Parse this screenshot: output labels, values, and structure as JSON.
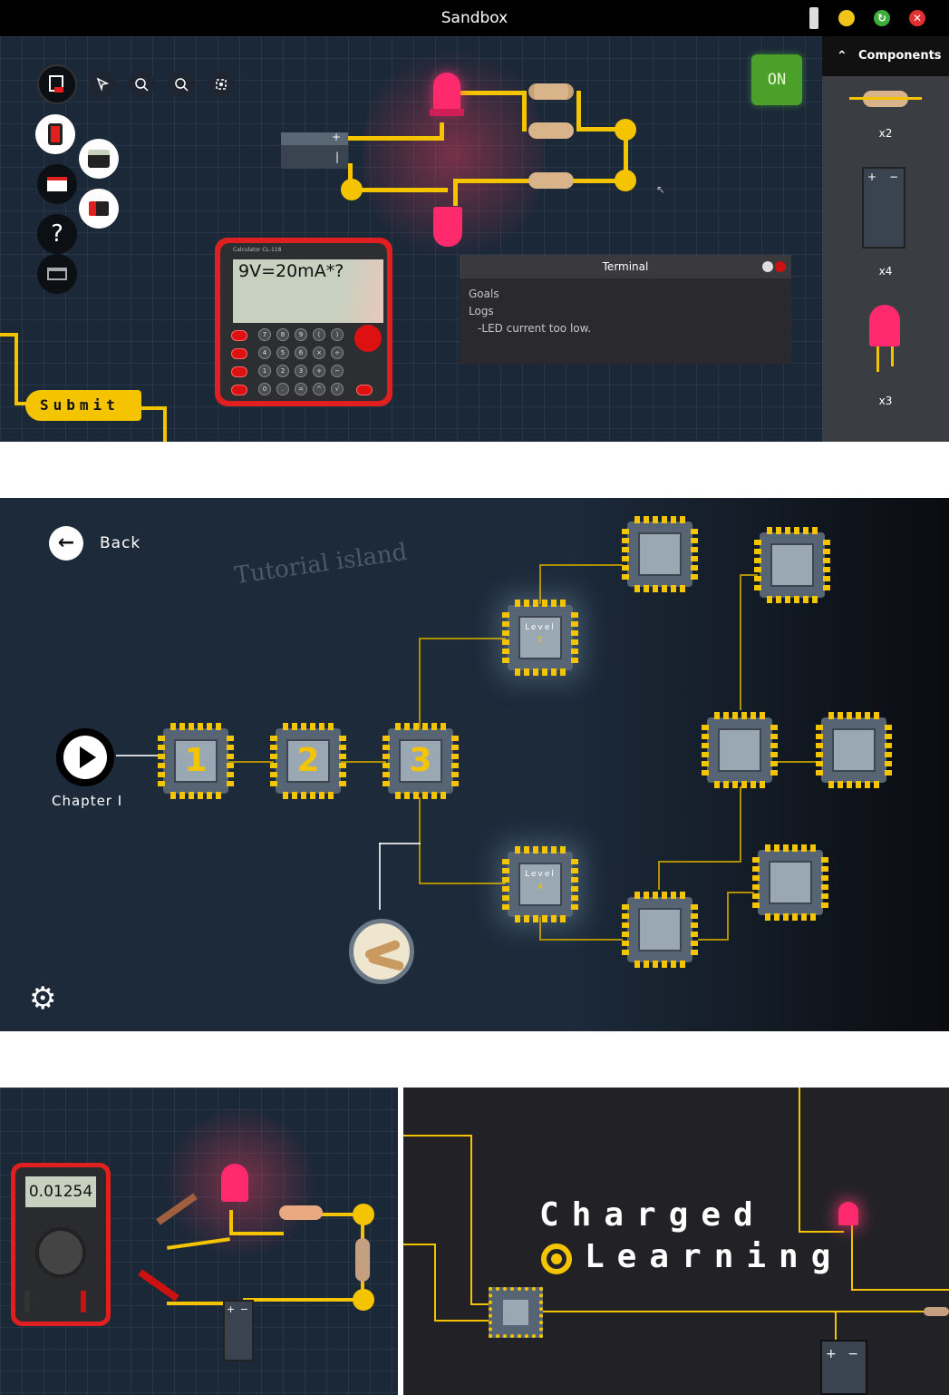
{
  "window": {
    "title": "Sandbox"
  },
  "sandbox": {
    "power_button": "ON",
    "components_header": "Components",
    "components": [
      {
        "name": "resistor",
        "count": "x2"
      },
      {
        "name": "battery",
        "count": "x4"
      },
      {
        "name": "led",
        "count": "x3"
      }
    ],
    "calculator": {
      "display": "9V=20mA*?",
      "brand": "Calculator",
      "model": "CL-118"
    },
    "terminal": {
      "title": "Terminal",
      "lines": [
        "Goals",
        "Logs",
        "-LED current too low."
      ]
    },
    "submit_label": "Submit",
    "help_label": "?"
  },
  "map": {
    "back_label": "Back",
    "island_title": "Tutorial island",
    "chapter_label": "Chapter I",
    "levels": [
      {
        "label": "1"
      },
      {
        "label": "2"
      },
      {
        "label": "3"
      },
      {
        "label": "Level",
        "num": "4"
      },
      {
        "label": "Level",
        "num": "5"
      }
    ]
  },
  "multimeter": {
    "display": "0.01254"
  },
  "splash": {
    "line1": "Charged",
    "line2": "Learning"
  },
  "colors": {
    "wire": "#f5c400",
    "led": "#ff2a6d",
    "accent_red": "#e02020",
    "on_green": "#4aa028"
  }
}
